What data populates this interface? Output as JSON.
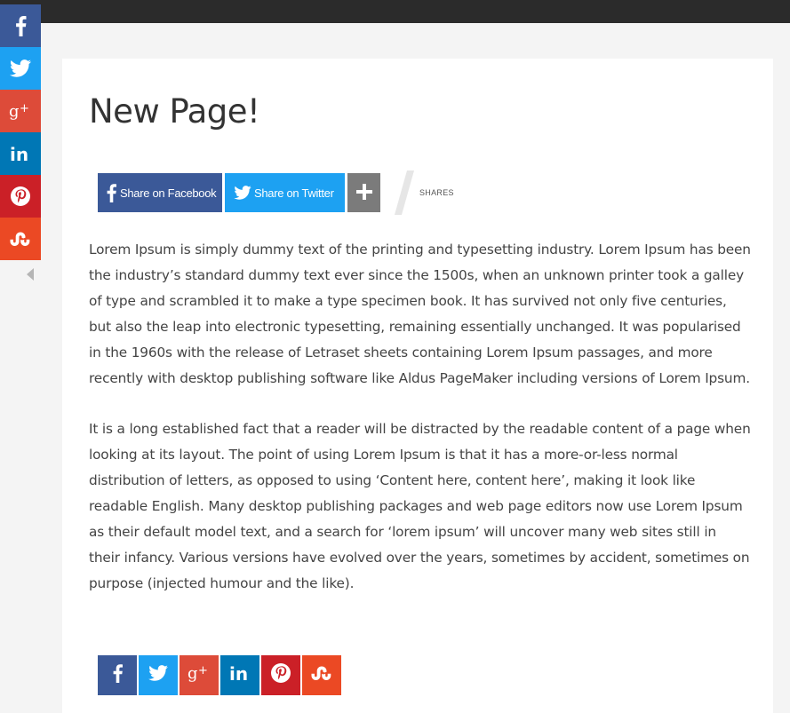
{
  "colors": {
    "facebook": "#3b5998",
    "twitter": "#1da1f2",
    "googleplus": "#dd4b39",
    "linkedin": "#0077b5",
    "pinterest": "#cb2027",
    "stumbleupon": "#eb4924",
    "more": "#7b7b7b"
  },
  "floating_bar": {
    "items": [
      {
        "network": "facebook",
        "icon": "facebook-icon"
      },
      {
        "network": "twitter",
        "icon": "twitter-icon"
      },
      {
        "network": "googleplus",
        "icon": "googleplus-icon"
      },
      {
        "network": "linkedin",
        "icon": "linkedin-icon"
      },
      {
        "network": "pinterest",
        "icon": "pinterest-icon"
      },
      {
        "network": "stumbleupon",
        "icon": "stumbleupon-icon"
      }
    ],
    "collapse_icon": "chevron-left-icon"
  },
  "page": {
    "title": "New Page!"
  },
  "share_bar": {
    "facebook_label": "Share on Facebook",
    "twitter_label": "Share on Twitter",
    "more_icon": "plus-icon",
    "shares_label": "SHARES"
  },
  "content": {
    "paragraphs": [
      "Lorem Ipsum is simply dummy text of the printing and typesetting industry. Lorem Ipsum has been the industry’s standard dummy text ever since the 1500s, when an unknown printer took a galley of type and scrambled it to make a type specimen book. It has survived not only five centuries, but also the leap into electronic typesetting, remaining essentially unchanged. It was popularised in the 1960s with the release of Letraset sheets containing Lorem Ipsum passages, and more recently with desktop publishing software like Aldus PageMaker including versions of Lorem Ipsum.",
      "It is a long established fact that a reader will be distracted by the readable content of a page when looking at its layout. The point of using Lorem Ipsum is that it has a more-or-less normal distribution of letters, as opposed to using ‘Content here, content here’, making it look like readable English. Many desktop publishing packages and web page editors now use Lorem Ipsum as their default model text, and a search for ‘lorem ipsum’ will uncover many web sites still in their infancy. Various versions have evolved over the years, sometimes by accident, sometimes on purpose (injected humour and the like)."
    ]
  },
  "bottom_bar": {
    "items": [
      {
        "network": "facebook",
        "icon": "facebook-icon"
      },
      {
        "network": "twitter",
        "icon": "twitter-icon"
      },
      {
        "network": "googleplus",
        "icon": "googleplus-icon"
      },
      {
        "network": "linkedin",
        "icon": "linkedin-icon"
      },
      {
        "network": "pinterest",
        "icon": "pinterest-icon"
      },
      {
        "network": "stumbleupon",
        "icon": "stumbleupon-icon"
      }
    ]
  }
}
